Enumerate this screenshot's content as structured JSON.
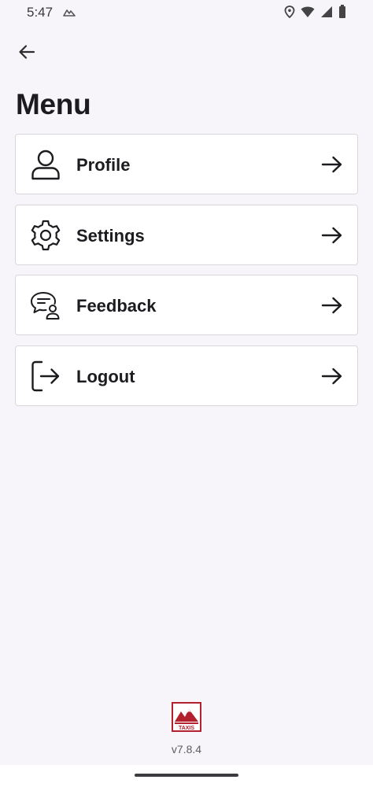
{
  "status_bar": {
    "time": "5:47",
    "left_icon": "mountain-notification-icon",
    "right_icons": [
      "location-icon",
      "wifi-icon",
      "signal-icon",
      "battery-icon"
    ]
  },
  "header": {
    "back_icon": "arrow-left-icon",
    "title": "Menu"
  },
  "menu": {
    "items": [
      {
        "label": "Profile",
        "icon": "person-icon",
        "trailing_icon": "arrow-right-icon"
      },
      {
        "label": "Settings",
        "icon": "gear-icon",
        "trailing_icon": "arrow-right-icon"
      },
      {
        "label": "Feedback",
        "icon": "chat-person-icon",
        "trailing_icon": "arrow-right-icon"
      },
      {
        "label": "Logout",
        "icon": "logout-icon",
        "trailing_icon": "arrow-right-icon"
      }
    ]
  },
  "footer": {
    "logo_text": "TAXIS",
    "version": "v7.8.4"
  },
  "colors": {
    "background": "#f7f5f9",
    "card": "#ffffff",
    "card_border": "#d9d7dc",
    "text": "#1c1b1f",
    "logo_red": "#b3202e"
  }
}
